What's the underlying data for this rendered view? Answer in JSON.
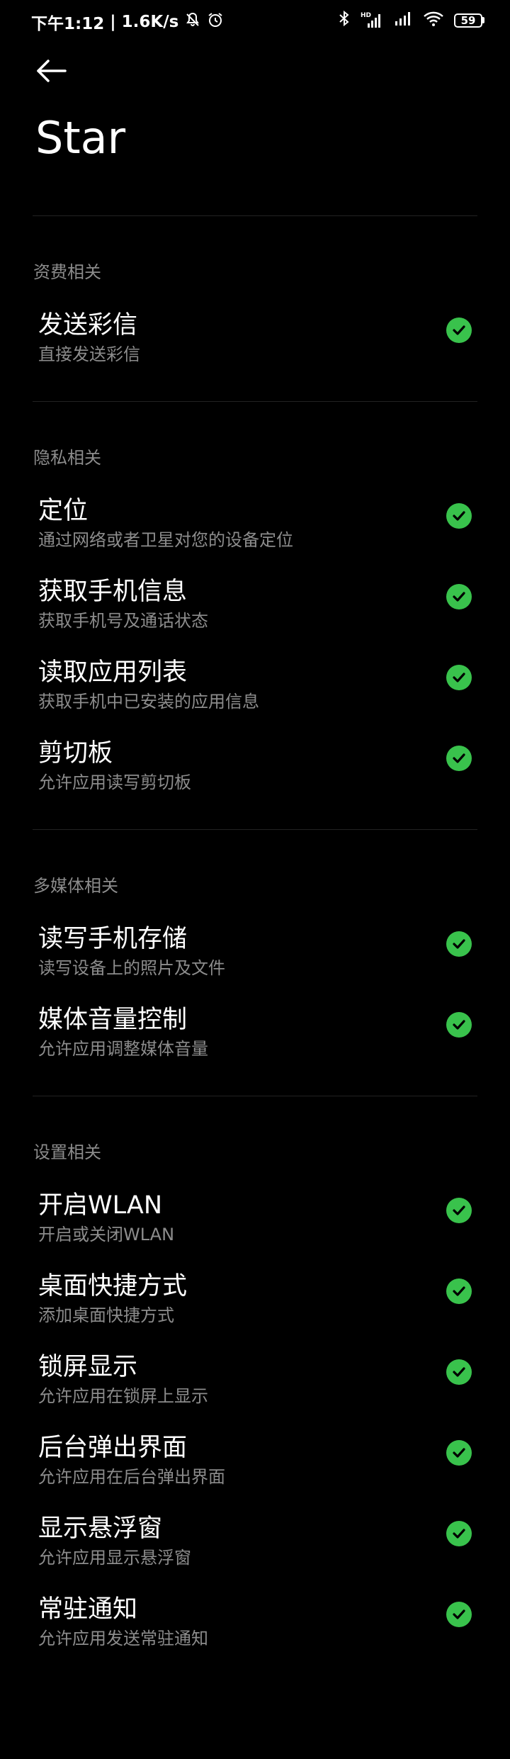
{
  "status_bar": {
    "time": "下午1:12",
    "separator": "|",
    "speed": "1.6K/s",
    "icons": [
      "mute-icon",
      "alarm-icon",
      "bluetooth-icon",
      "signal-icon",
      "signal-icon-2",
      "wifi-icon",
      "battery-icon"
    ],
    "signal_label": "HD",
    "battery_level": "59"
  },
  "header": {
    "back_icon": "back-arrow-icon",
    "title": "Star"
  },
  "colors": {
    "background": "#000000",
    "text_primary": "#ffffff",
    "text_secondary": "#8c8c8c",
    "check_green": "#39c24c",
    "divider": "#222222"
  },
  "sections": [
    {
      "title": "资费相关",
      "items": [
        {
          "title": "发送彩信",
          "desc": "直接发送彩信",
          "enabled": true
        }
      ]
    },
    {
      "title": "隐私相关",
      "items": [
        {
          "title": "定位",
          "desc": "通过网络或者卫星对您的设备定位",
          "enabled": true
        },
        {
          "title": "获取手机信息",
          "desc": "获取手机号及通话状态",
          "enabled": true
        },
        {
          "title": "读取应用列表",
          "desc": "获取手机中已安装的应用信息",
          "enabled": true
        },
        {
          "title": "剪切板",
          "desc": "允许应用读写剪切板",
          "enabled": true
        }
      ]
    },
    {
      "title": "多媒体相关",
      "items": [
        {
          "title": "读写手机存储",
          "desc": "读写设备上的照片及文件",
          "enabled": true
        },
        {
          "title": "媒体音量控制",
          "desc": "允许应用调整媒体音量",
          "enabled": true
        }
      ]
    },
    {
      "title": "设置相关",
      "items": [
        {
          "title": "开启WLAN",
          "desc": "开启或关闭WLAN",
          "enabled": true
        },
        {
          "title": "桌面快捷方式",
          "desc": "添加桌面快捷方式",
          "enabled": true
        },
        {
          "title": "锁屏显示",
          "desc": "允许应用在锁屏上显示",
          "enabled": true
        },
        {
          "title": "后台弹出界面",
          "desc": "允许应用在后台弹出界面",
          "enabled": true
        },
        {
          "title": "显示悬浮窗",
          "desc": "允许应用显示悬浮窗",
          "enabled": true
        },
        {
          "title": "常驻通知",
          "desc": "允许应用发送常驻通知",
          "enabled": true
        }
      ]
    }
  ]
}
